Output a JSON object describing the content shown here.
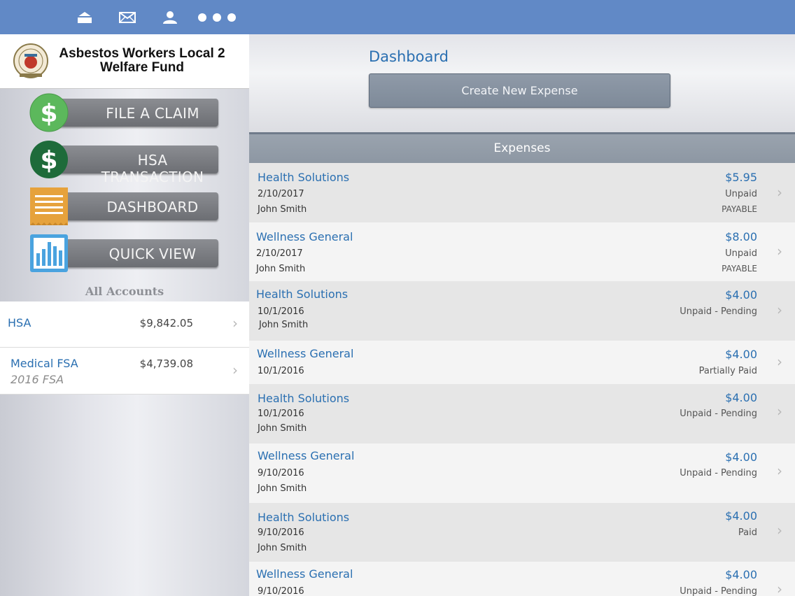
{
  "topbar": {
    "icons": [
      "home-icon",
      "mail-icon",
      "user-icon",
      "more-icon"
    ]
  },
  "sidebar": {
    "org_name_line1": "Asbestos Workers Local 2",
    "org_name_line2": "Welfare Fund",
    "menu": [
      {
        "label": "FILE A CLAIM",
        "icon": "dollar-icon",
        "color": "#5cb85c"
      },
      {
        "label": "HSA TRANSACTION",
        "icon": "dollar-icon",
        "color": "#1e6b3a"
      },
      {
        "label": "DASHBOARD",
        "icon": "document-icon",
        "color": "#e6a23c"
      },
      {
        "label": "QUICK VIEW",
        "icon": "bar-chart-icon",
        "color": "#4aa3df"
      }
    ],
    "accounts_heading": "All Accounts",
    "accounts": [
      {
        "name": "HSA",
        "value": "$9,842.05",
        "sub": ""
      },
      {
        "name": "Medical FSA",
        "value": "$4,739.08",
        "sub": "2016 FSA"
      }
    ]
  },
  "main": {
    "title": "Dashboard",
    "create_button": "Create New Expense",
    "expenses_header": "Expenses",
    "expenses": [
      {
        "payee": "Health Solutions",
        "date": "2/10/2017",
        "person": "John Smith",
        "amount": "$5.95",
        "status": "Unpaid",
        "flag": "PAYABLE"
      },
      {
        "payee": "Wellness General",
        "date": "2/10/2017",
        "person": "John Smith",
        "amount": "$8.00",
        "status": "Unpaid",
        "flag": "PAYABLE"
      },
      {
        "payee": "Health Solutions",
        "date": "10/1/2016",
        "person": "John Smith",
        "amount": "$4.00",
        "status": "Unpaid - Pending",
        "flag": ""
      },
      {
        "payee": "Wellness General",
        "date": "10/1/2016",
        "person": "",
        "amount": "$4.00",
        "status": "Partially Paid",
        "flag": ""
      },
      {
        "payee": "Health Solutions",
        "date": "10/1/2016",
        "person": "John Smith",
        "amount": "$4.00",
        "status": "Unpaid - Pending",
        "flag": ""
      },
      {
        "payee": "Wellness General",
        "date": "9/10/2016",
        "person": "John Smith",
        "amount": "$4.00",
        "status": "Unpaid - Pending",
        "flag": ""
      },
      {
        "payee": "Health Solutions",
        "date": "9/10/2016",
        "person": "John Smith",
        "amount": "$4.00",
        "status": "Paid",
        "flag": ""
      },
      {
        "payee": "Wellness General",
        "date": "9/10/2016",
        "person": "",
        "amount": "$4.00",
        "status": "Unpaid - Pending",
        "flag": ""
      }
    ]
  },
  "colors": {
    "topbar": "#6189c6",
    "link_blue": "#2a6fb1",
    "menu_bar": "#7a7c81"
  }
}
